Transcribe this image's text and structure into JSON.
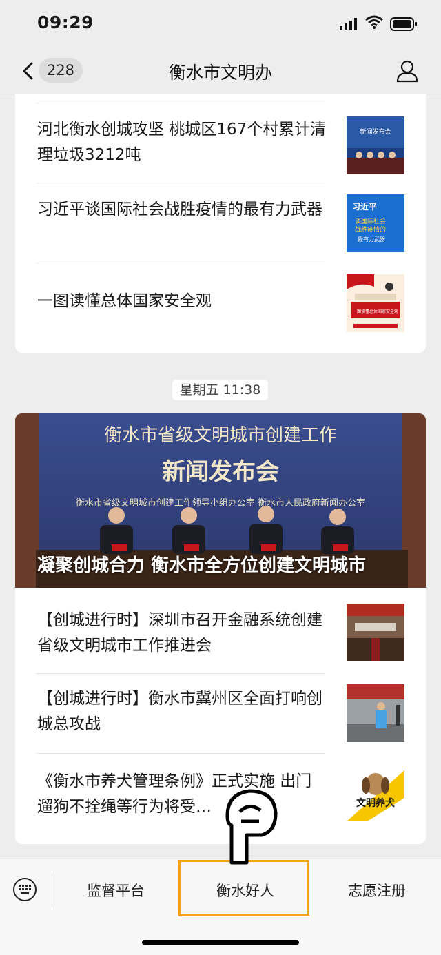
{
  "status": {
    "time": "09:29"
  },
  "nav": {
    "back_count": "228",
    "title": "衡水市文明办"
  },
  "articles_top": [
    {
      "title": "河北衡水创城攻坚 桃城区167个村累计清理垃圾3212吨",
      "thumb_alt": "新闻发布会"
    },
    {
      "title": "习近平谈国际社会战胜疫情的最有力武器",
      "thumb_text": [
        "习近平",
        "谈国际社会",
        "战胜疫情的",
        "最有力武器"
      ]
    },
    {
      "title": "一图读懂总体国家安全观",
      "thumb_text": "一图读懂总体国家安全观"
    }
  ],
  "timestamp": "星期五 11:38",
  "hero": {
    "banner_line1": "衡水市省级文明城市创建工作",
    "banner_line2": "新闻发布会",
    "banner_line3": "衡水市省级文明城市创建工作领导小组办公室    衡水市人民政府新闻办公室",
    "caption": "凝聚创城合力 衡水市全方位创建文明城市"
  },
  "articles_bottom": [
    {
      "title": "【创城进行时】深圳市召开金融系统创建省级文明城市工作推进会"
    },
    {
      "title": "【创城进行时】衡水市冀州区全面打响创城总攻战"
    },
    {
      "title": "《衡水市养犬管理条例》正式实施 出门遛狗不拴绳等行为将受…",
      "thumb_text": "文明养犬"
    }
  ],
  "menu": {
    "item1": "监督平台",
    "item2": "衡水好人",
    "item3": "志愿注册"
  },
  "colors": {
    "highlight": "#f5a21b",
    "background": "#ededed"
  }
}
